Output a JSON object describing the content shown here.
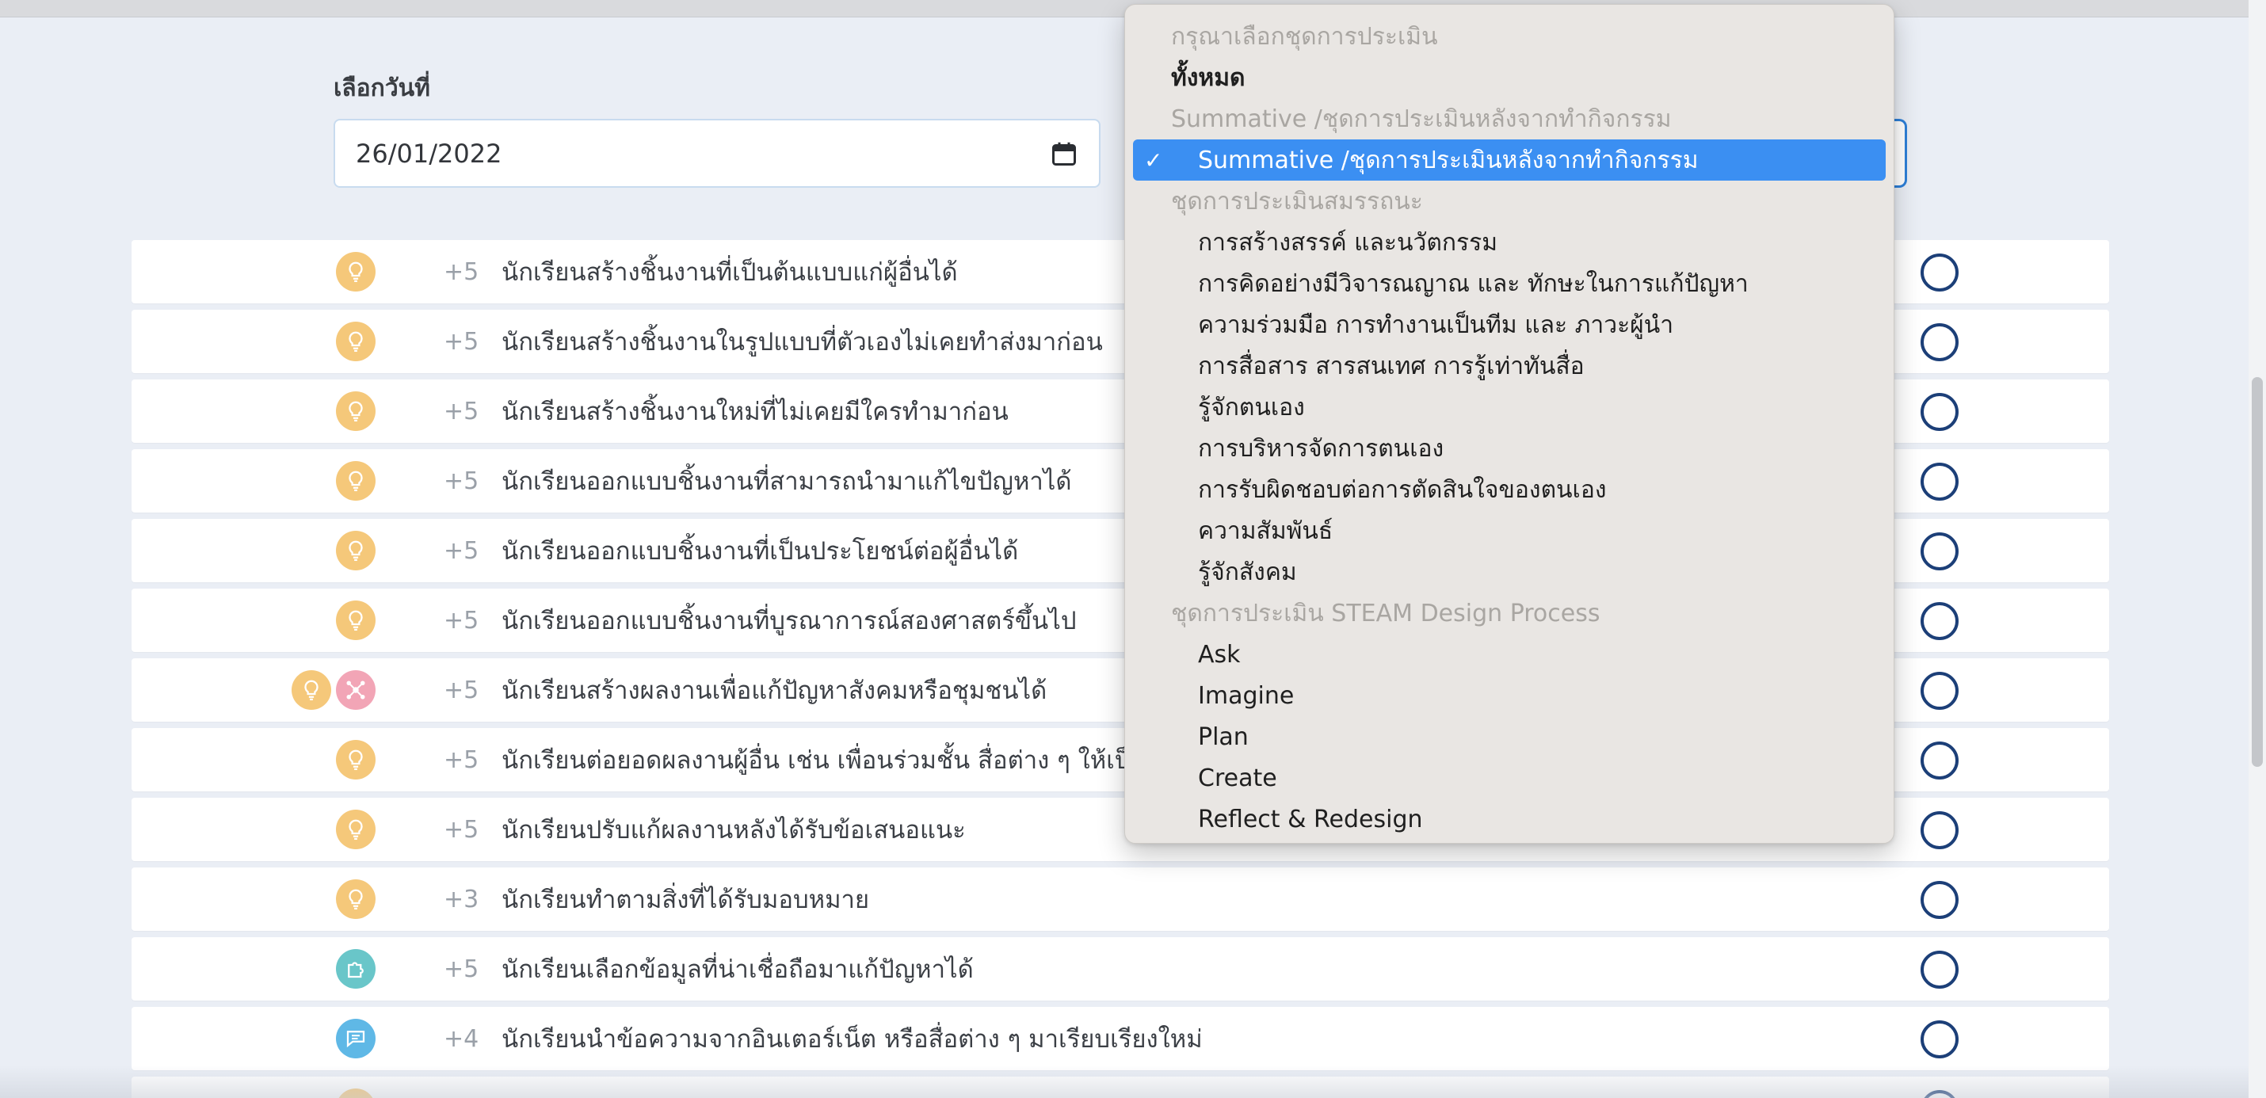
{
  "form": {
    "date_label": "เลือกวันที่",
    "date_value": "26/01/2022"
  },
  "dropdown": {
    "items": [
      {
        "label": "กรุณาเลือกชุดการประเมิน",
        "kind": "header"
      },
      {
        "label": "ทั้งหมด",
        "kind": "bold"
      },
      {
        "label": "Summative /ชุดการประเมินหลังจากทำกิจกรรม",
        "kind": "header"
      },
      {
        "label": "Summative /ชุดการประเมินหลังจากทำกิจกรรม",
        "kind": "selected",
        "checkmark": "✓"
      },
      {
        "label": "ชุดการประเมินสมรรถนะ",
        "kind": "header"
      },
      {
        "label": "การสร้างสรรค์ และนวัตกรรม",
        "kind": "opt"
      },
      {
        "label": "การคิดอย่างมีวิจารณญาณ และ ทักษะในการแก้ปัญหา",
        "kind": "opt"
      },
      {
        "label": "ความร่วมมือ การทำงานเป็นทีม และ ภาวะผู้นำ",
        "kind": "opt"
      },
      {
        "label": "การสื่อสาร สารสนเทศ การรู้เท่าทันสื่อ",
        "kind": "opt"
      },
      {
        "label": "รู้จักตนเอง",
        "kind": "opt"
      },
      {
        "label": "การบริหารจัดการตนเอง",
        "kind": "opt"
      },
      {
        "label": "การรับผิดชอบต่อการตัดสินใจของตนเอง",
        "kind": "opt"
      },
      {
        "label": "ความสัมพันธ์",
        "kind": "opt"
      },
      {
        "label": "รู้จักสังคม",
        "kind": "opt"
      },
      {
        "label": "ชุดการประเมิน STEAM Design Process",
        "kind": "header"
      },
      {
        "label": "Ask",
        "kind": "opt"
      },
      {
        "label": "Imagine",
        "kind": "opt"
      },
      {
        "label": "Plan",
        "kind": "opt"
      },
      {
        "label": "Create",
        "kind": "opt"
      },
      {
        "label": "Reflect & Redesign",
        "kind": "opt"
      }
    ]
  },
  "criteria": [
    {
      "icons": [
        "lightbulb-icon"
      ],
      "points": "+5",
      "text": "นักเรียนสร้างชิ้นงานที่เป็นต้นแบบแก่ผู้อื่นได้"
    },
    {
      "icons": [
        "lightbulb-icon"
      ],
      "points": "+5",
      "text": "นักเรียนสร้างชิ้นงานในรูปแบบที่ตัวเองไม่เคยทำส่งมาก่อน"
    },
    {
      "icons": [
        "lightbulb-icon"
      ],
      "points": "+5",
      "text": "นักเรียนสร้างชิ้นงานใหม่ที่ไม่เคยมีใครทำมาก่อน"
    },
    {
      "icons": [
        "lightbulb-icon"
      ],
      "points": "+5",
      "text": "นักเรียนออกแบบชิ้นงานที่สามารถนำมาแก้ไขปัญหาได้"
    },
    {
      "icons": [
        "lightbulb-icon"
      ],
      "points": "+5",
      "text": "นักเรียนออกแบบชิ้นงานที่เป็นประโยชน์ต่อผู้อื่นได้"
    },
    {
      "icons": [
        "lightbulb-icon"
      ],
      "points": "+5",
      "text": "นักเรียนออกแบบชิ้นงานที่บูรณาการณ์สองศาสตร์ขึ้นไป"
    },
    {
      "icons": [
        "lightbulb-icon",
        "network-icon"
      ],
      "points": "+5",
      "text": "นักเรียนสร้างผลงานเพื่อแก้ปัญหาสังคมหรือชุมชนได้"
    },
    {
      "icons": [
        "lightbulb-icon"
      ],
      "points": "+5",
      "text": "นักเรียนต่อยอดผลงานผู้อื่น เช่น เพื่อนร่วมชั้น สื่อต่าง ๆ ให้เป็น"
    },
    {
      "icons": [
        "lightbulb-icon"
      ],
      "points": "+5",
      "text": "นักเรียนปรับแก้ผลงานหลังได้รับข้อเสนอแนะ"
    },
    {
      "icons": [
        "lightbulb-icon"
      ],
      "points": "+3",
      "text": "นักเรียนทำตามสิ่งที่ได้รับมอบหมาย"
    },
    {
      "icons": [
        "puzzle-icon"
      ],
      "points": "+5",
      "text": "นักเรียนเลือกข้อมูลที่น่าเชื่อถือมาแก้ปัญหาได้"
    },
    {
      "icons": [
        "chat-icon"
      ],
      "points": "+4",
      "text": "นักเรียนนำข้อความจากอินเตอร์เน็ต หรือสื่อต่าง ๆ มาเรียบเรียงใหม่"
    },
    {
      "icons": [
        "lightbulb-icon"
      ],
      "points": "",
      "text": ""
    }
  ]
}
